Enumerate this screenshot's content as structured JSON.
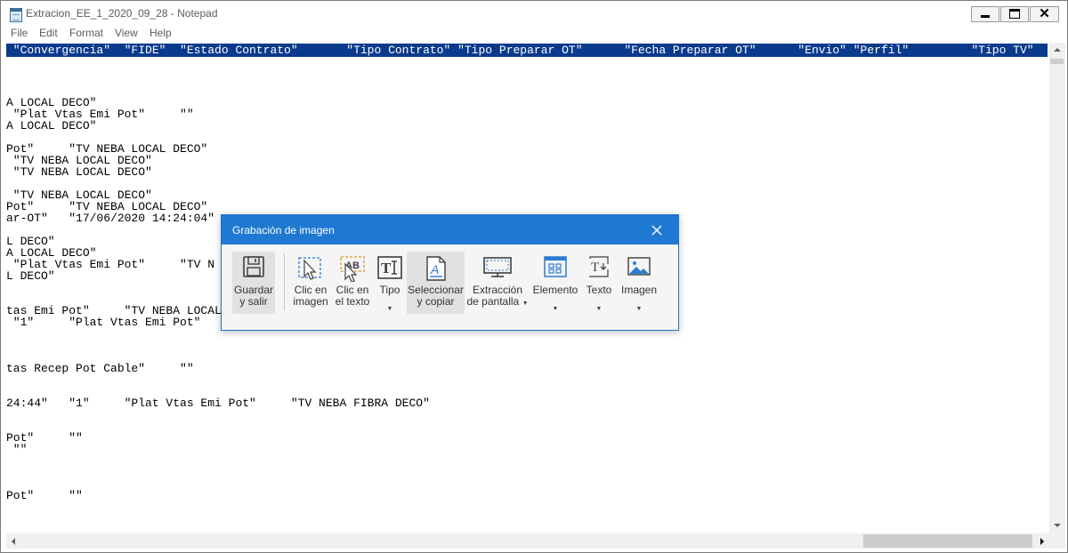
{
  "window": {
    "title": "Extracion_EE_1_2020_09_28 - Notepad",
    "icon": "notepad-icon"
  },
  "menu": [
    "File",
    "Edit",
    "Format",
    "View",
    "Help"
  ],
  "editor": {
    "header_line": " \"Convergencia\"  \"FIDE\"  \"Estado Contrato\"       \"Tipo Contrato\" \"Tipo Preparar OT\"      \"Fecha Preparar OT\"      \"Envio\" \"Perfil\"         \"Tipo TV\"",
    "lines": [
      {
        "row": 5,
        "text": "A LOCAL DECO\""
      },
      {
        "row": 6,
        "text": " \"Plat Vtas Emi Pot\"     \"\""
      },
      {
        "row": 7,
        "text": "A LOCAL DECO\""
      },
      {
        "row": 9,
        "text": "Pot\"     \"TV NEBA LOCAL DECO\""
      },
      {
        "row": 10,
        "text": " \"TV NEBA LOCAL DECO\""
      },
      {
        "row": 11,
        "text": " \"TV NEBA LOCAL DECO\""
      },
      {
        "row": 13,
        "text": " \"TV NEBA LOCAL DECO\""
      },
      {
        "row": 14,
        "text": "Pot\"     \"TV NEBA LOCAL DECO\""
      },
      {
        "row": 15,
        "text": "ar-OT\"   \"17/06/2020 14:24:04\""
      },
      {
        "row": 17,
        "text": "L DECO\""
      },
      {
        "row": 18,
        "text": "A LOCAL DECO\""
      },
      {
        "row": 19,
        "text": " \"Plat Vtas Emi Pot\"     \"TV N"
      },
      {
        "row": 20,
        "text": "L DECO\""
      },
      {
        "row": 23,
        "text": "tas Emi Pot\"     \"TV NEBA LOCAL DECO\""
      },
      {
        "row": 24,
        "text": " \"1\"     \"Plat Vtas Emi Pot\"     \"TV NEBA LOCAL DECO\""
      },
      {
        "row": 28,
        "text": "tas Recep Pot Cable\"     \"\""
      },
      {
        "row": 31,
        "text": "24:44\"   \"1\"     \"Plat Vtas Emi Pot\"     \"TV NEBA FIBRA DECO\""
      },
      {
        "row": 34,
        "text": "Pot\"     \"\""
      },
      {
        "row": 35,
        "text": " \"\""
      },
      {
        "row": 39,
        "text": "Pot\"     \"\""
      }
    ]
  },
  "dialog": {
    "title": "Grabación de imagen",
    "tools": [
      {
        "id": "save",
        "label1": "Guardar",
        "label2": "y salir",
        "icon": "floppy-disk-icon",
        "dropdown": false,
        "active": true
      },
      {
        "id": "click-image",
        "label1": "Clic en",
        "label2": "imagen",
        "icon": "image-click-icon",
        "dropdown": false,
        "active": false
      },
      {
        "id": "click-text",
        "label1": "Clic en",
        "label2": "el texto",
        "icon": "text-click-icon",
        "dropdown": false,
        "active": false
      },
      {
        "id": "type",
        "label1": "Tipo",
        "label2": "",
        "icon": "type-text-icon",
        "dropdown": true,
        "active": false
      },
      {
        "id": "select-copy",
        "label1": "Seleccionar",
        "label2": "y copiar",
        "icon": "select-copy-icon",
        "dropdown": false,
        "active": true
      },
      {
        "id": "screen-extract",
        "label1": "Extracción",
        "label2": "de pantalla",
        "icon": "monitor-icon",
        "dropdown": true,
        "active": false
      },
      {
        "id": "element",
        "label1": "Elemento",
        "label2": "",
        "icon": "element-grid-icon",
        "dropdown": true,
        "active": false
      },
      {
        "id": "text",
        "label1": "Texto",
        "label2": "",
        "icon": "text-tool-icon",
        "dropdown": true,
        "active": false
      },
      {
        "id": "image",
        "label1": "Imagen",
        "label2": "",
        "icon": "picture-icon",
        "dropdown": true,
        "active": false
      }
    ],
    "close_icon": "close-icon"
  },
  "colors": {
    "selection": "#0a3a8c",
    "dialog_header": "#1f78d1",
    "accent": "#1a73d1"
  }
}
